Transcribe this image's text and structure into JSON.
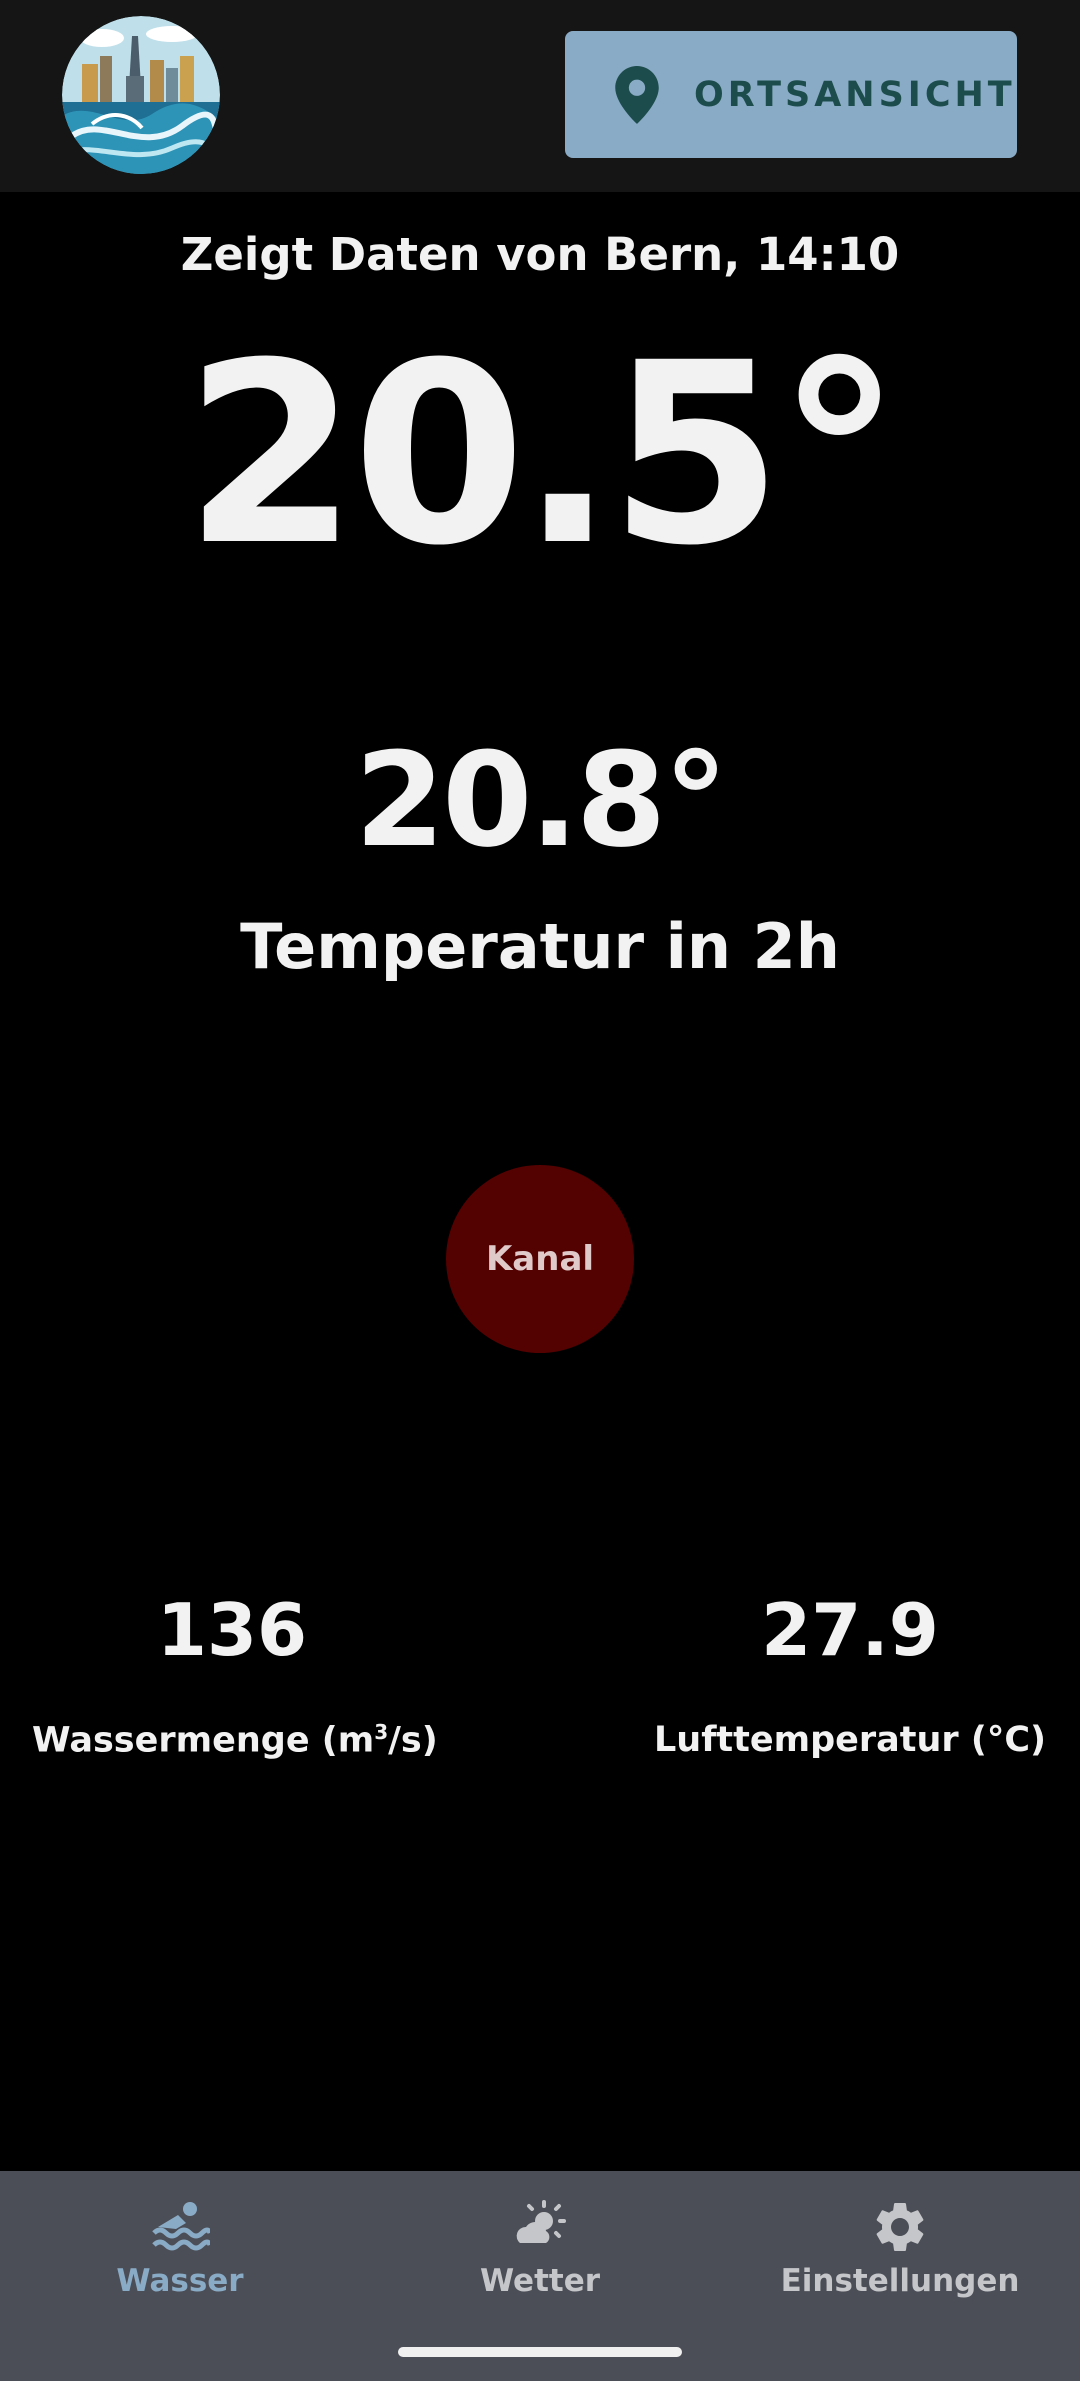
{
  "header": {
    "logo_name": "city-river-logo",
    "location_button": {
      "icon": "map-pin-icon",
      "label": "ORTSANSICHT"
    }
  },
  "main": {
    "subtitle": "Zeigt Daten von Bern, 14:10",
    "current_temp": "20.5°",
    "forecast_temp": "20.8°",
    "forecast_label": "Temperatur in 2h",
    "location_badge": "Kanal",
    "stats": [
      {
        "value": "136",
        "label": "Wassermenge (m",
        "unit_sup": "3",
        "label_suffix": "/s)"
      },
      {
        "value": "27.9",
        "label": "Lufttemperatur (°C)"
      }
    ]
  },
  "bottom_nav": {
    "items": [
      {
        "label": "Wasser",
        "icon": "swimming-icon",
        "active": true
      },
      {
        "label": "Wetter",
        "icon": "weather-icon",
        "active": false
      },
      {
        "label": "Einstellungen",
        "icon": "gear-icon",
        "active": false
      }
    ]
  },
  "colors": {
    "accent": "#8aabc6",
    "badge": "#540101",
    "nav_bg": "#4b4e56",
    "header_bg": "#151515"
  }
}
